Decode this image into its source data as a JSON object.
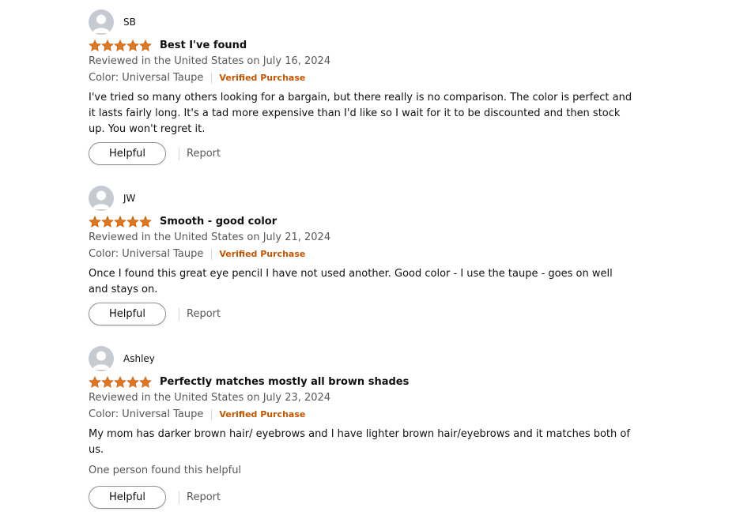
{
  "reviews": [
    {
      "profile_name": "SB",
      "rating": 5,
      "title": "Best I've found",
      "date": "Reviewed in the United States on July 16, 2024",
      "format": "Color: Universal Taupe",
      "verified": "Verified Purchase",
      "body": "I've tried so many others looking for a bargain, but there really is no comparison. The color is perfect and it lasts fairly long. It's a tad more expensive than I'd like so I wait for it to be discounted and then stock up. You won't regret it.",
      "helpful_count": "",
      "helpful_label": "Helpful",
      "report_label": "Report"
    },
    {
      "profile_name": "JW",
      "rating": 5,
      "title": "Smooth - good color",
      "date": "Reviewed in the United States on July 21, 2024",
      "format": "Color: Universal Taupe",
      "verified": "Verified Purchase",
      "body": "Once I found this great eye pencil I have not used another. Good color - I use the taupe - goes on well and stays on.",
      "helpful_count": "",
      "helpful_label": "Helpful",
      "report_label": "Report"
    },
    {
      "profile_name": "Ashley",
      "rating": 5,
      "title": "Perfectly matches mostly all brown shades",
      "date": "Reviewed in the United States on July 23, 2024",
      "format": "Color: Universal Taupe",
      "verified": "Verified Purchase",
      "body": "My mom has darker brown hair/ eyebrows and I have lighter brown hair/eyebrows and it matches both of us.",
      "helpful_count": "One person found this helpful",
      "helpful_label": "Helpful",
      "report_label": "Report"
    }
  ],
  "icons": {
    "avatar": "default-profile-avatar-icon",
    "star": "star-icon"
  },
  "colors": {
    "star": "#de7921",
    "verified": "#c45500",
    "muted_text": "#565959",
    "avatar_bg": "#c6cbd1"
  }
}
